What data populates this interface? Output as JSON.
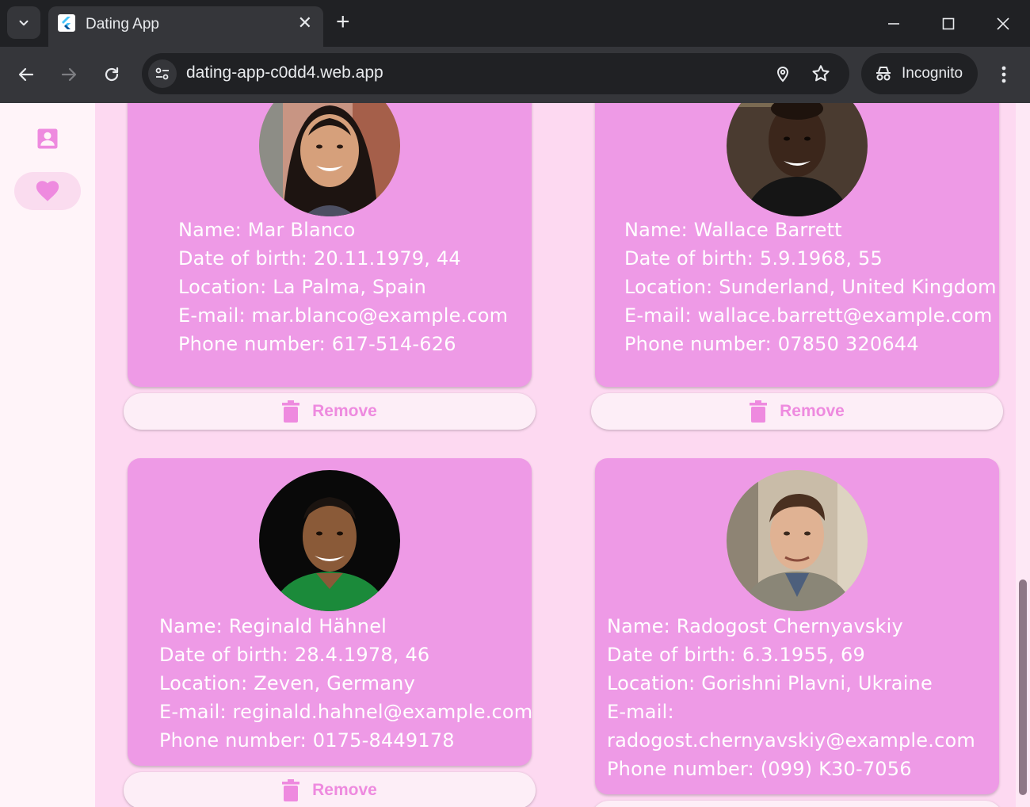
{
  "browser": {
    "tab_title": "Dating App",
    "url": "dating-app-c0dd4.web.app",
    "incognito_label": "Incognito"
  },
  "nav": {
    "items": [
      {
        "icon": "profile-icon",
        "active": false
      },
      {
        "icon": "heart-icon",
        "active": true
      }
    ]
  },
  "profiles": [
    {
      "name": "Name: Mar Blanco",
      "dob": "Date of birth: 20.11.1979, 44",
      "location": "Location: La Palma, Spain",
      "email": "E-mail: mar.blanco@example.com",
      "phone": "Phone number: 617-514-626",
      "remove_label": "Remove"
    },
    {
      "name": "Name: Wallace Barrett",
      "dob": "Date of birth: 5.9.1968, 55",
      "location": "Location: Sunderland, United Kingdom",
      "email": "E-mail: wallace.barrett@example.com",
      "phone": "Phone number: 07850 320644",
      "remove_label": "Remove"
    },
    {
      "name": "Name: Reginald Hähnel",
      "dob": "Date of birth: 28.4.1978, 46",
      "location": "Location: Zeven, Germany",
      "email": "E-mail: reginald.hahnel@example.com",
      "phone": "Phone number: 0175-8449178",
      "remove_label": "Remove"
    },
    {
      "name": "Name: Radogost Chernyavskiy",
      "dob": "Date of birth: 6.3.1955, 69",
      "location": "Location: Gorishni Plavni, Ukraine",
      "email_label": "E-mail:",
      "email_value": "radogost.chernyavskiy@example.com",
      "phone": "Phone number: (099) K30-7056"
    }
  ],
  "colors": {
    "card": "#ee9ae6",
    "background": "#fdd9f1",
    "accent": "#ee8adf",
    "button_bg": "#fdeef7"
  }
}
